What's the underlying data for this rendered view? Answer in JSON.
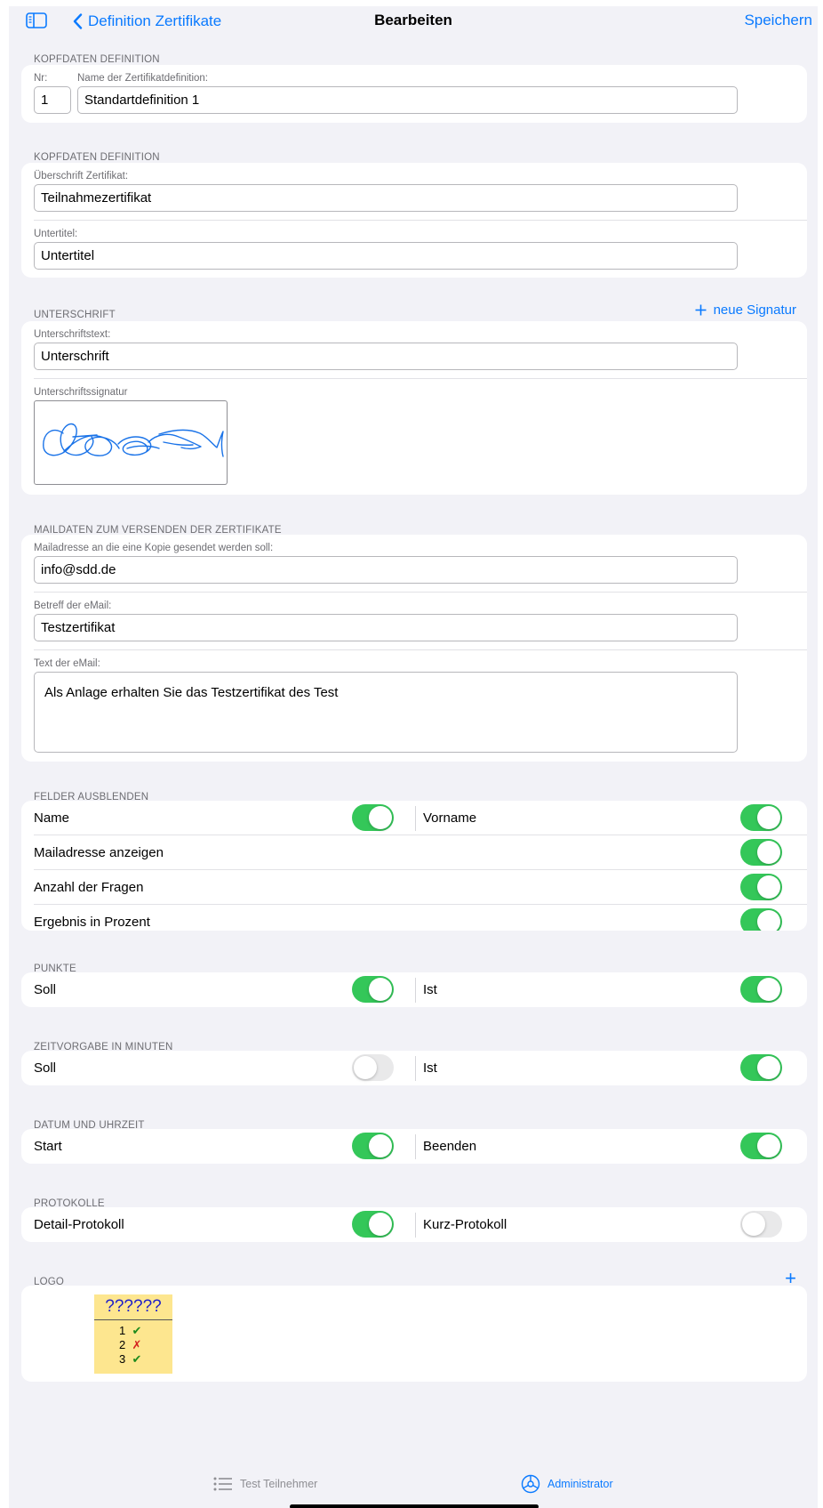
{
  "nav": {
    "back_label": "Definition Zertifikate",
    "title": "Bearbeiten",
    "save_label": "Speichern"
  },
  "section_head": {
    "header": "KOPFDATEN DEFINITION",
    "nr_label": "Nr:",
    "nr_value": "1",
    "name_label": "Name der Zertifikatdefinition:",
    "name_value": "Standartdefinition 1"
  },
  "section_head2": {
    "header": "KOPFDATEN DEFINITION",
    "headline_label": "Überschrift Zertifikat:",
    "headline_value": "Teilnahmezertifikat",
    "subtitle_label": "Untertitel:",
    "subtitle_value": "Untertitel"
  },
  "signature": {
    "header": "UNTERSCHRIFT",
    "new_signature_label": "neue Signatur",
    "text_label": "Unterschriftstext:",
    "text_value": "Unterschrift",
    "signature_label": "Unterschriftssignatur",
    "ink_color": "#1a73e8"
  },
  "mail": {
    "header": "MAILDATEN ZUM VERSENDEN DER ZERTIFIKATE",
    "copy_label": "Mailadresse an die eine Kopie gesendet werden soll:",
    "copy_value": "info@sdd.de",
    "subject_label": "Betreff der eMail:",
    "subject_value": "Testzertifikat",
    "body_label": "Text der eMail:",
    "body_value": "Als Anlage erhalten Sie das Testzertifikat des Test"
  },
  "hide_fields": {
    "header": "FELDER AUSBLENDEN",
    "name_label": "Name",
    "name_on": true,
    "firstname_label": "Vorname",
    "firstname_on": true,
    "mail_label": "Mailadresse anzeigen",
    "mail_on": true,
    "questions_label": "Anzahl der Fragen",
    "questions_on": true,
    "percent_label": "Ergebnis in Prozent",
    "percent_on": true
  },
  "points": {
    "header": "PUNKTE",
    "target_label": "Soll",
    "target_on": true,
    "actual_label": "Ist",
    "actual_on": true
  },
  "time": {
    "header": "ZEITVORGABE IN MINUTEN",
    "target_label": "Soll",
    "target_on": false,
    "actual_label": "Ist",
    "actual_on": true
  },
  "datetime": {
    "header": "DATUM UND UHRZEIT",
    "start_label": "Start",
    "start_on": true,
    "end_label": "Beenden",
    "end_on": true
  },
  "protocols": {
    "header": "PROTOKOLLE",
    "detail_label": "Detail-Protokoll",
    "detail_on": true,
    "short_label": "Kurz-Protokoll",
    "short_on": false
  },
  "logo": {
    "header": "LOGO",
    "add_symbol": "+",
    "title": "??????",
    "rows": [
      {
        "num": "1",
        "mark": "✔"
      },
      {
        "num": "2",
        "mark": "✗"
      },
      {
        "num": "3",
        "mark": "✔"
      }
    ],
    "bg_color": "#fde68f",
    "check_color": "#1c8a1c",
    "cross_color": "#d42020",
    "title_color": "#2020c8"
  },
  "tabbar": {
    "tab1_label": "Test Teilnehmer",
    "tab2_label": "Administrator"
  },
  "colors": {
    "accent": "#0a7aff",
    "toggle_on": "#34c759",
    "toggle_off": "#e9e9ea",
    "background": "#f2f2f7"
  }
}
